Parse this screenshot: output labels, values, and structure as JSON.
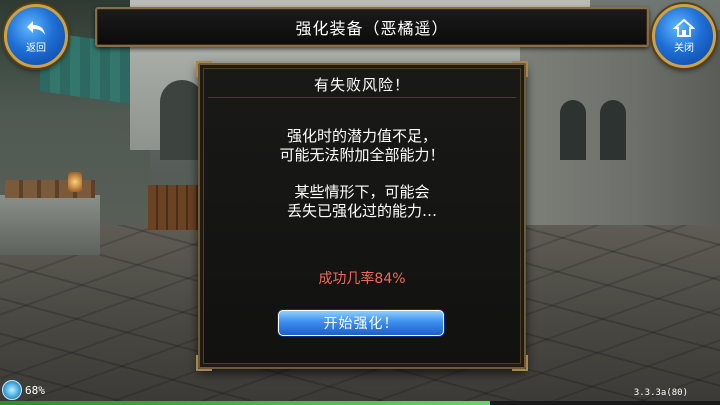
{
  "header": {
    "title": "强化装备（恶橘遥）",
    "back_label": "返回",
    "close_label": "关闭"
  },
  "dialog": {
    "title": "有失败风险！",
    "paragraph1": [
      "强化时的潜力值不足，",
      "可能无法附加全部能力！"
    ],
    "paragraph2": [
      "某些情形下，可能会",
      "丢失已强化过的能力…"
    ],
    "success_rate": "成功几率84%",
    "start_button": "开始强化！"
  },
  "status": {
    "energy": "68%",
    "version": "3.3.3a(80)",
    "exp_progress": 0.68
  },
  "colors": {
    "success_rate": "#f06a5c",
    "button_blue": "#3d8ff0",
    "frame_gold": "#8a6d45"
  },
  "icons": {
    "back": "back-arrow-icon",
    "close": "home-icon",
    "energy": "energy-orb-icon"
  }
}
